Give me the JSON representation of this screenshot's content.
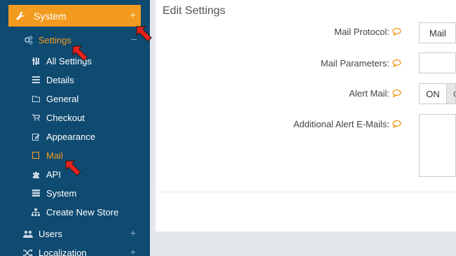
{
  "sidebar": {
    "system": {
      "label": "System",
      "toggle": "+"
    },
    "settings": {
      "label": "Settings",
      "toggle": "–"
    },
    "children": [
      {
        "label": "All Settings",
        "icon": "sliders-icon"
      },
      {
        "label": "Details",
        "icon": "list-icon"
      },
      {
        "label": "General",
        "icon": "folder-icon"
      },
      {
        "label": "Checkout",
        "icon": "cart-icon"
      },
      {
        "label": "Appearance",
        "icon": "edit-icon"
      },
      {
        "label": "Mail",
        "icon": "square-icon",
        "active": true
      },
      {
        "label": "API",
        "icon": "puzzle-icon"
      },
      {
        "label": "System",
        "icon": "server-icon"
      },
      {
        "label": "Create New Store",
        "icon": "sitemap-icon"
      }
    ],
    "users": {
      "label": "Users",
      "toggle": "+"
    },
    "localization": {
      "label": "Localization",
      "toggle": "+"
    }
  },
  "main": {
    "title": "Edit Settings",
    "fields": {
      "mail_protocol": {
        "label": "Mail Protocol:",
        "value": "Mail"
      },
      "mail_parameters": {
        "label": "Mail Parameters:",
        "value": ""
      },
      "alert_mail": {
        "label": "Alert Mail:",
        "on": "ON",
        "off": "OFF"
      },
      "additional_alert_emails": {
        "label": "Additional Alert E-Mails:",
        "value": ""
      }
    }
  },
  "colors": {
    "sidebar_bg": "#0f4a71",
    "accent": "#f39b1f",
    "help_icon": "#f39b1f",
    "arrow": "#e8211a"
  }
}
